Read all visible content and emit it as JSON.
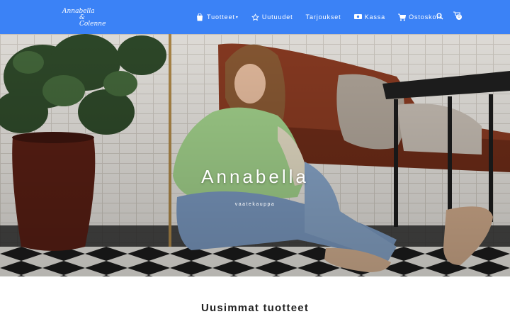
{
  "brand": {
    "logo_line1": "Annabella",
    "logo_line2": "& Colenne"
  },
  "nav": {
    "items": [
      {
        "label": "Tuotteet",
        "icon": "bag-icon",
        "has_dropdown": true
      },
      {
        "label": "Uutuudet",
        "icon": "star-icon",
        "has_dropdown": false
      },
      {
        "label": "Tarjoukset",
        "icon": "",
        "has_dropdown": false
      },
      {
        "label": "Kassa",
        "icon": "cash-icon",
        "has_dropdown": false
      },
      {
        "label": "Ostoskori",
        "icon": "cart-icon",
        "has_dropdown": false
      }
    ],
    "dropdown_caret": "▾",
    "cart_count": "0"
  },
  "hero": {
    "title": "Annabella",
    "subtitle": "vaatekauppa"
  },
  "section": {
    "title": "Uusimmat tuotteet"
  },
  "colors": {
    "header": "#3b82f6",
    "text": "#222222"
  }
}
